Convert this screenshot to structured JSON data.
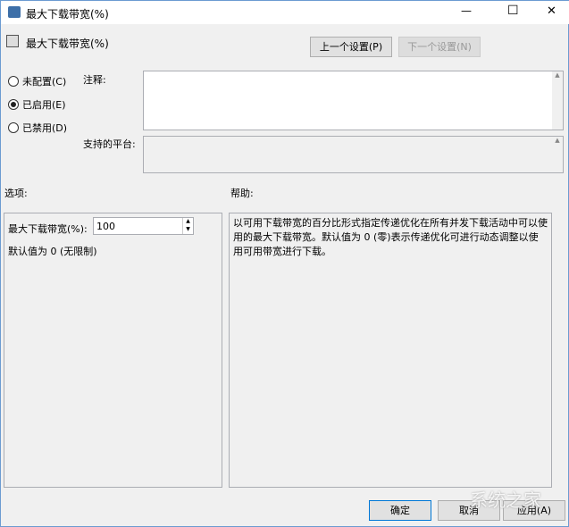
{
  "window": {
    "title": "最大下载带宽(%)",
    "minimize": "—",
    "maximize": "☐",
    "close": "✕"
  },
  "header": {
    "title": "最大下载带宽(%)",
    "prev_button": "上一个设置(P)",
    "next_button": "下一个设置(N)"
  },
  "radios": [
    {
      "label": "未配置(C)",
      "checked": false
    },
    {
      "label": "已启用(E)",
      "checked": true
    },
    {
      "label": "已禁用(D)",
      "checked": false
    }
  ],
  "comment_label": "注释:",
  "platform_label": "支持的平台:",
  "options_label": "选项:",
  "help_label": "帮助:",
  "options": {
    "field_label": "最大下载带宽(%):",
    "field_value": "100",
    "default_note": "默认值为 0 (无限制)"
  },
  "help_text": "以可用下载带宽的百分比形式指定传递优化在所有并发下载活动中可以使用的最大下载带宽。默认值为 0 (零)表示传递优化可进行动态调整以使用可用带宽进行下载。",
  "footer": {
    "ok": "确定",
    "cancel": "取消",
    "apply": "应用(A)"
  },
  "watermark": "系统之家"
}
